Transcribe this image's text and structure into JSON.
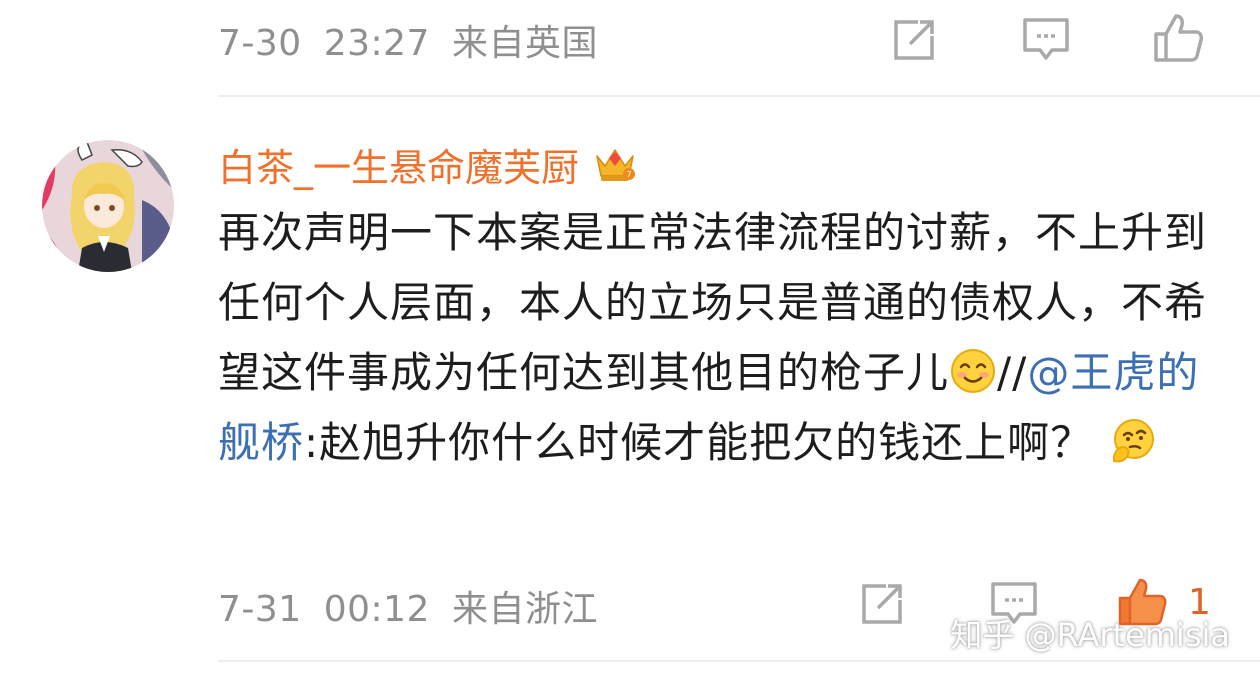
{
  "top_comment": {
    "date": "7-30",
    "time": "23:27",
    "source": "来自英国"
  },
  "main_comment": {
    "username": "白茶_一生悬命魔芙厨",
    "text_part1": "再次声明一下本案是正常法律流程的讨薪，不上升到任何个人层面，本人的立场只是普通的债权人，不希望这件事成为任何达到其他目的枪子儿",
    "text_sep": "//",
    "mention": "@王虎的舰桥",
    "text_part2": ":赵旭升你什么时候才能把欠的钱还上啊？",
    "date": "7-31",
    "time": "00:12",
    "source": "来自浙江",
    "like_count": "1"
  },
  "watermark": "知乎 @RArtemisia",
  "icons": {
    "forward": "share-forward-icon",
    "comment": "comment-icon",
    "like": "thumbs-up-icon",
    "badge": "crown-badge-icon"
  },
  "colors": {
    "username": "#f0712c",
    "mention": "#3c6fb3",
    "meta": "#8f8f8f",
    "like_active": "#f07a2e"
  }
}
